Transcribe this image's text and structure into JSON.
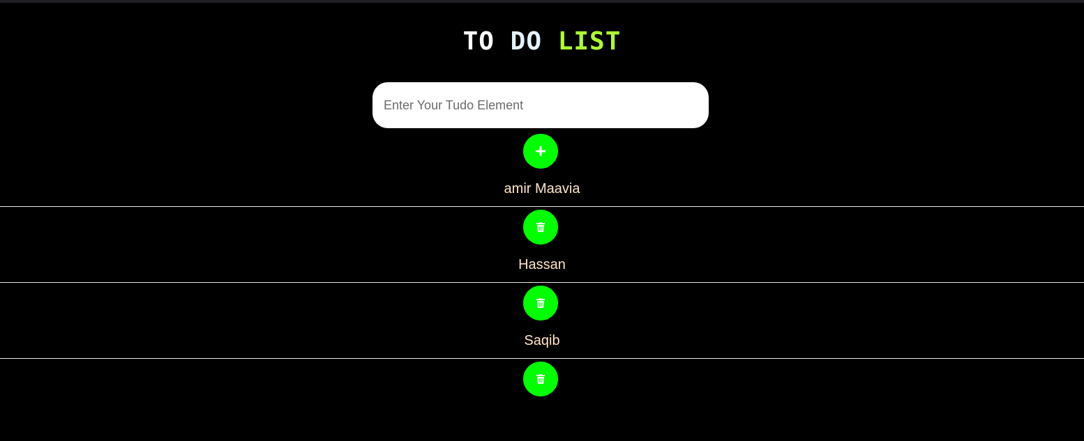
{
  "app": {
    "title_part1": "TO",
    "title_part2": "DO",
    "title_part3": "LIST"
  },
  "input": {
    "placeholder": "Enter Your Tudo Element",
    "value": ""
  },
  "add_button": {
    "icon": "plus-icon"
  },
  "todos": [
    {
      "text": "amir Maavia",
      "delete_icon": "trash-icon"
    },
    {
      "text": "Hassan",
      "delete_icon": "trash-icon"
    },
    {
      "text": "Saqib",
      "delete_icon": "trash-icon"
    }
  ],
  "colors": {
    "background": "#000000",
    "accent_green": "#00ff00",
    "title_highlight": "#adff2f",
    "item_text": "#ffe4c4"
  }
}
